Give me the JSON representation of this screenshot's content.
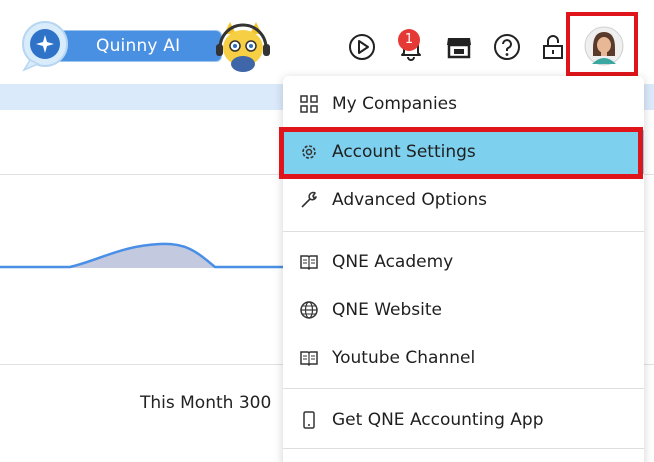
{
  "header": {
    "assistant_label": "Quinny AI",
    "notification_count": "1"
  },
  "menu": {
    "items": [
      {
        "label": "My Companies",
        "icon": "grid-icon"
      },
      {
        "label": "Account Settings",
        "icon": "gear-icon",
        "selected": true
      },
      {
        "label": "Advanced Options",
        "icon": "wrench-icon"
      },
      {
        "label": "QNE Academy",
        "icon": "book-icon"
      },
      {
        "label": "QNE Website",
        "icon": "globe-icon"
      },
      {
        "label": "Youtube Channel",
        "icon": "book-icon"
      },
      {
        "label": "Get QNE Accounting App",
        "icon": "phone-icon"
      }
    ]
  },
  "background": {
    "month_text": "This Month 300"
  },
  "colors": {
    "brand_blue": "#4a90e2",
    "highlight": "#7ed0ef",
    "annotation_red": "#e0151b",
    "badge_red": "#e53935"
  }
}
